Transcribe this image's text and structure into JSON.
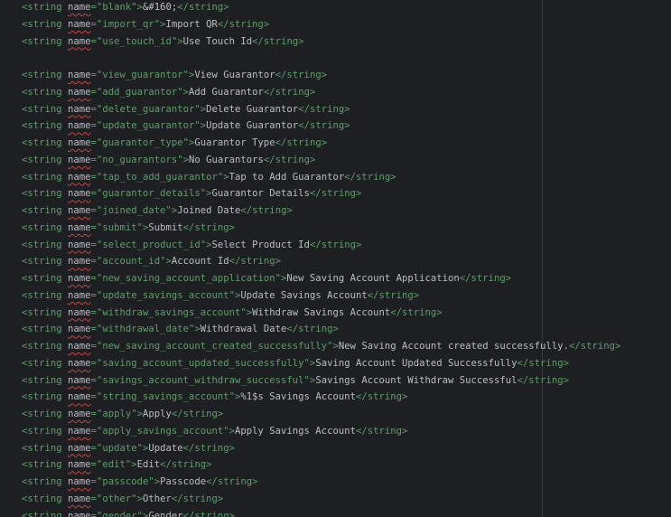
{
  "lines": [
    {
      "name": "blank",
      "text": "&#160;"
    },
    {
      "name": "import_qr",
      "text": "Import QR"
    },
    {
      "name": "use_touch_id",
      "text": "Use Touch Id"
    },
    null,
    {
      "name": "view_guarantor",
      "text": "View Guarantor"
    },
    {
      "name": "add_guarantor",
      "text": "Add Guarantor"
    },
    {
      "name": "delete_guarantor",
      "text": "Delete Guarantor"
    },
    {
      "name": "update_guarantor",
      "text": "Update Guarantor"
    },
    {
      "name": "guarantor_type",
      "text": "Guarantor Type"
    },
    {
      "name": "no_guarantors",
      "text": "No Guarantors"
    },
    {
      "name": "tap_to_add_guarantor",
      "text": "Tap to Add Guarantor"
    },
    {
      "name": "guarantor_details",
      "text": "Guarantor Details"
    },
    {
      "name": "joined_date",
      "text": "Joined Date"
    },
    {
      "name": "submit",
      "text": "Submit"
    },
    {
      "name": "select_product_id",
      "text": "Select Product Id"
    },
    {
      "name": "account_id",
      "text": "Account Id"
    },
    {
      "name": "new_saving_account_application",
      "text": "New Saving Account Application"
    },
    {
      "name": "update_savings_account",
      "text": "Update Savings Account"
    },
    {
      "name": "withdraw_savings_account",
      "text": "Withdraw Savings Account"
    },
    {
      "name": "withdrawal_date",
      "text": "Withdrawal Date"
    },
    {
      "name": "new_saving_account_created_successfully",
      "text": "New Saving Account created successfully."
    },
    {
      "name": "saving_account_updated_successfully",
      "text": "Saving Account Updated Successfully"
    },
    {
      "name": "savings_account_withdraw_successful",
      "text": "Savings Account Withdraw Successful"
    },
    {
      "name": "string_savings_account",
      "text": "%1$s Savings Account"
    },
    {
      "name": "apply",
      "text": "Apply"
    },
    {
      "name": "apply_savings_account",
      "text": "Apply Savings Account"
    },
    {
      "name": "update",
      "text": "Update"
    },
    {
      "name": "edit",
      "text": "Edit"
    },
    {
      "name": "passcode",
      "text": "Passcode"
    },
    {
      "name": "other",
      "text": "Other"
    },
    {
      "name": "gender",
      "text": "Gender"
    }
  ],
  "colors": {
    "background": "#1e1f22",
    "tag": "#5f9e6a",
    "text": "#bcbec4",
    "error_underline": "#c9453f"
  }
}
